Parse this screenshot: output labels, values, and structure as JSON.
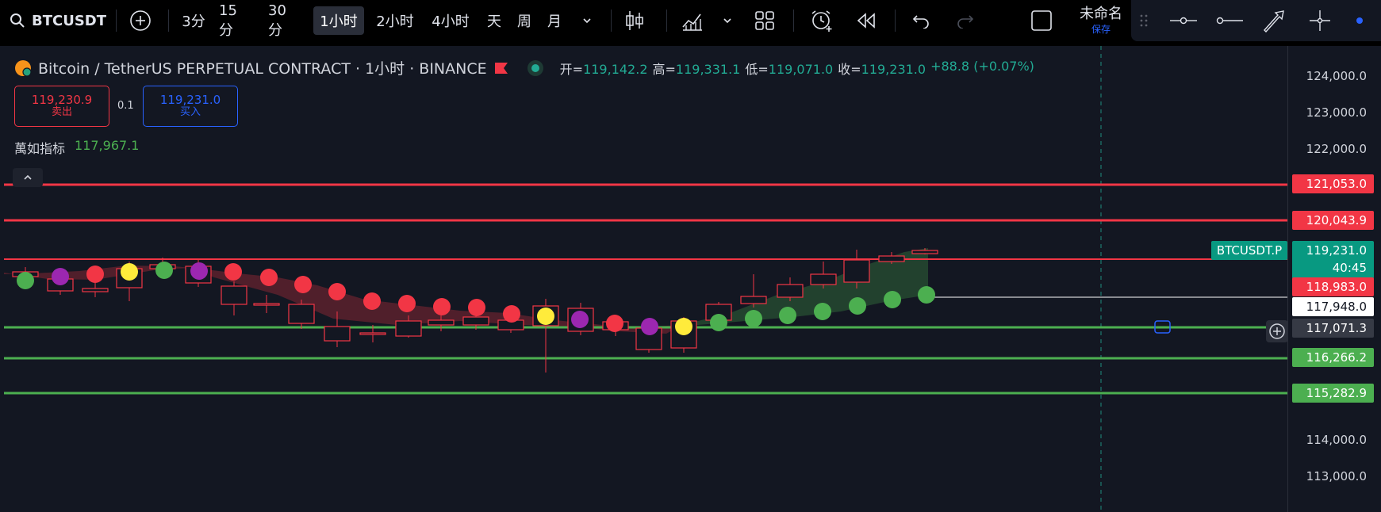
{
  "toolbar": {
    "symbol": "BTCUSDT",
    "add_icon": "plus-circle-icon",
    "intervals": [
      "3分",
      "15分",
      "30分",
      "1小时",
      "2小时",
      "4小时",
      "天",
      "周",
      "月"
    ],
    "active_interval": "1小时",
    "layout_title": "未命名",
    "layout_save": "保存"
  },
  "legend": {
    "title": "Bitcoin / TetherUS PERPETUAL CONTRACT · 1小时 · BINANCE",
    "open_label": "开=",
    "open": "119,142.2",
    "high_label": "高=",
    "high": "119,331.1",
    "low_label": "低=",
    "low": "119,071.0",
    "close_label": "收=",
    "close": "119,231.0",
    "change": "+88.8 (+0.07%)"
  },
  "trade": {
    "sell_price": "119,230.9",
    "sell_label": "卖出",
    "spread": "0.1",
    "buy_price": "119,231.0",
    "buy_label": "买入"
  },
  "indicator": {
    "name": "萬如指标",
    "value": "117,967.1"
  },
  "price_scale": {
    "ticks": [
      "124,000.0",
      "123,000.0",
      "122,000.0",
      "114,000.0",
      "113,000.0"
    ],
    "current_symbol": "BTCUSDT.P",
    "current_price": "119,231.0",
    "countdown": "40:45",
    "level_labels": [
      {
        "price": "121,053.0",
        "color": "#f23645"
      },
      {
        "price": "120,043.9",
        "color": "#f23645"
      },
      {
        "price": "118,983.0",
        "color": "#f23645"
      },
      {
        "price": "117,948.0",
        "color": "#ffffff"
      },
      {
        "price": "117,071.3",
        "color": "#363a45"
      },
      {
        "price": "116,266.2",
        "color": "#4caf50"
      },
      {
        "price": "115,282.9",
        "color": "#4caf50"
      }
    ]
  },
  "colors": {
    "up": "#22ab94",
    "down": "#f23645",
    "support": "#4caf50",
    "dot_yellow": "#ffeb3b",
    "dot_purple": "#9c27b0"
  }
}
